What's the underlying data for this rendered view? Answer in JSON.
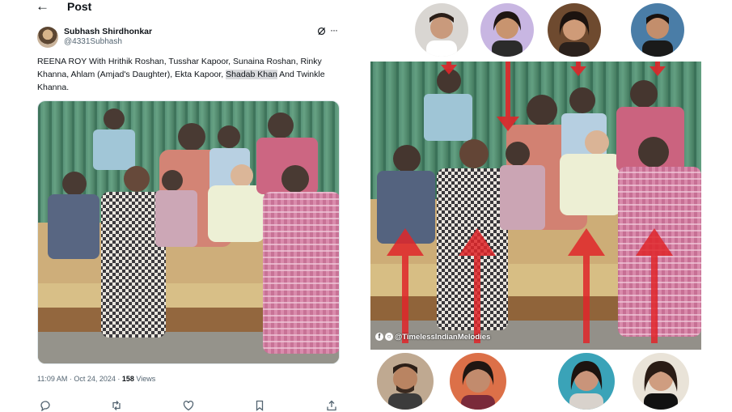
{
  "header": {
    "back_icon": "arrow-left-icon",
    "title": "Post"
  },
  "author": {
    "name": "Subhash Shirdhonkar",
    "handle": "@4331Subhash"
  },
  "post": {
    "text_before": "REENA ROY With Hrithik Roshan, Tusshar Kapoor, Sunaina Roshan, Rinky Khanna, Ahlam (Amjad's Daughter), Ekta Kapoor, ",
    "text_highlight": "Shadab Khan",
    "text_after": " And Twinkle Khanna."
  },
  "meta": {
    "time": "11:09 AM · Oct 24, 2024 · ",
    "views_count": "158",
    "views_label": " Views"
  },
  "actions": [
    "reply-icon",
    "repost-icon",
    "like-icon",
    "bookmark-icon",
    "share-icon"
  ],
  "collage": {
    "watermark": "@TimelessIndianMelodies"
  },
  "colors": {
    "highlight": "#d9dadd",
    "arrow": "#e0262a",
    "muted_text": "#536471"
  }
}
